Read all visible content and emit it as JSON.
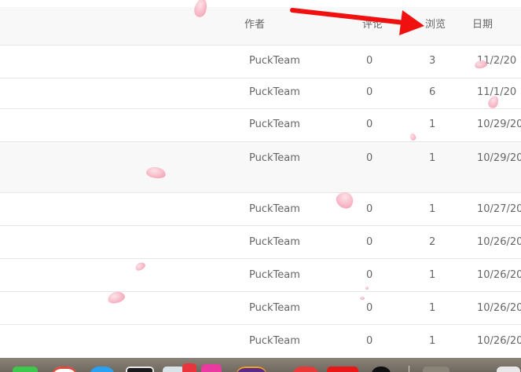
{
  "table": {
    "headers": {
      "author": "作者",
      "comments": "评论",
      "views": "浏览",
      "date": "日期"
    },
    "rows": [
      {
        "author": "PuckTeam",
        "comments": "0",
        "views": "3",
        "date": "11/2/20"
      },
      {
        "author": "PuckTeam",
        "comments": "0",
        "views": "6",
        "date": "11/1/20"
      },
      {
        "author": "PuckTeam",
        "comments": "0",
        "views": "1",
        "date": "10/29/20"
      },
      {
        "author": "PuckTeam",
        "comments": "0",
        "views": "1",
        "date": "10/29/20"
      },
      {
        "author": "PuckTeam",
        "comments": "0",
        "views": "1",
        "date": "10/27/20"
      },
      {
        "author": "PuckTeam",
        "comments": "0",
        "views": "2",
        "date": "10/26/20"
      },
      {
        "author": "PuckTeam",
        "comments": "0",
        "views": "1",
        "date": "10/26/20"
      },
      {
        "author": "PuckTeam",
        "comments": "0",
        "views": "1",
        "date": "10/26/20"
      },
      {
        "author": "PuckTeam",
        "comments": "0",
        "views": "1",
        "date": "10/26/20"
      }
    ]
  },
  "annotation": {
    "arrow_color": "#f01010"
  },
  "decoration": {
    "petal_color": "#f6aebe"
  },
  "dock": {
    "icons": [
      "messages-icon",
      "chrome-icon",
      "safari-icon",
      "terminal-icon",
      "preview-icon",
      "photos-icon",
      "app-icon",
      "browser-icon",
      "adobe-icon",
      "video-icon",
      "notion-icon",
      "finder-icon",
      "trash-icon"
    ]
  }
}
